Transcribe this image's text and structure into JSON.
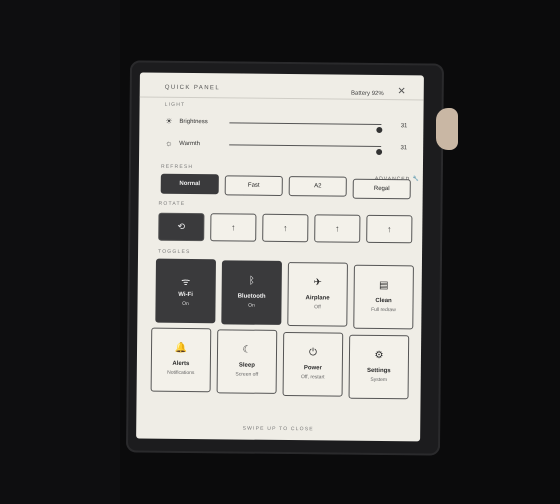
{
  "panel": {
    "title": "QUICK PANEL",
    "battery": "Battery 92%",
    "close": "✕"
  },
  "light": {
    "label": "LIGHT",
    "brightness": {
      "label": "Brightness",
      "value": "31",
      "level": 0.97
    },
    "warmth": {
      "label": "Warmth",
      "value": "31",
      "level": 0.97
    }
  },
  "refresh": {
    "label": "REFRESH",
    "advanced": "ADVANCED",
    "modes": [
      "Normal",
      "Fast",
      "A2",
      "Regal"
    ],
    "selected": "Normal"
  },
  "rotate": {
    "label": "ROTATE",
    "options": [
      "auto-rotate-icon",
      "portrait-icon",
      "landscape-left-icon",
      "landscape-right-icon",
      "portrait-flipped-icon"
    ],
    "selected_index": 0
  },
  "toggles": {
    "label": "TOGGLES",
    "items": [
      {
        "name": "Wi-Fi",
        "status": "On",
        "icon": "wifi-icon",
        "active": true
      },
      {
        "name": "Bluetooth",
        "status": "On",
        "icon": "bluetooth-icon",
        "active": true
      },
      {
        "name": "Airplane",
        "status": "Off",
        "icon": "airplane-icon",
        "active": false
      },
      {
        "name": "Clean",
        "status": "Full redraw",
        "icon": "clean-icon",
        "active": false
      },
      {
        "name": "Alerts",
        "status": "Notifications",
        "icon": "bell-icon",
        "active": false
      },
      {
        "name": "Sleep",
        "status": "Screen off",
        "icon": "moon-icon",
        "active": false
      },
      {
        "name": "Power",
        "status": "Off, restart",
        "icon": "power-icon",
        "active": false
      },
      {
        "name": "Settings",
        "status": "System",
        "icon": "gear-icon",
        "active": false
      }
    ]
  },
  "footer": "SWIPE UP TO CLOSE"
}
